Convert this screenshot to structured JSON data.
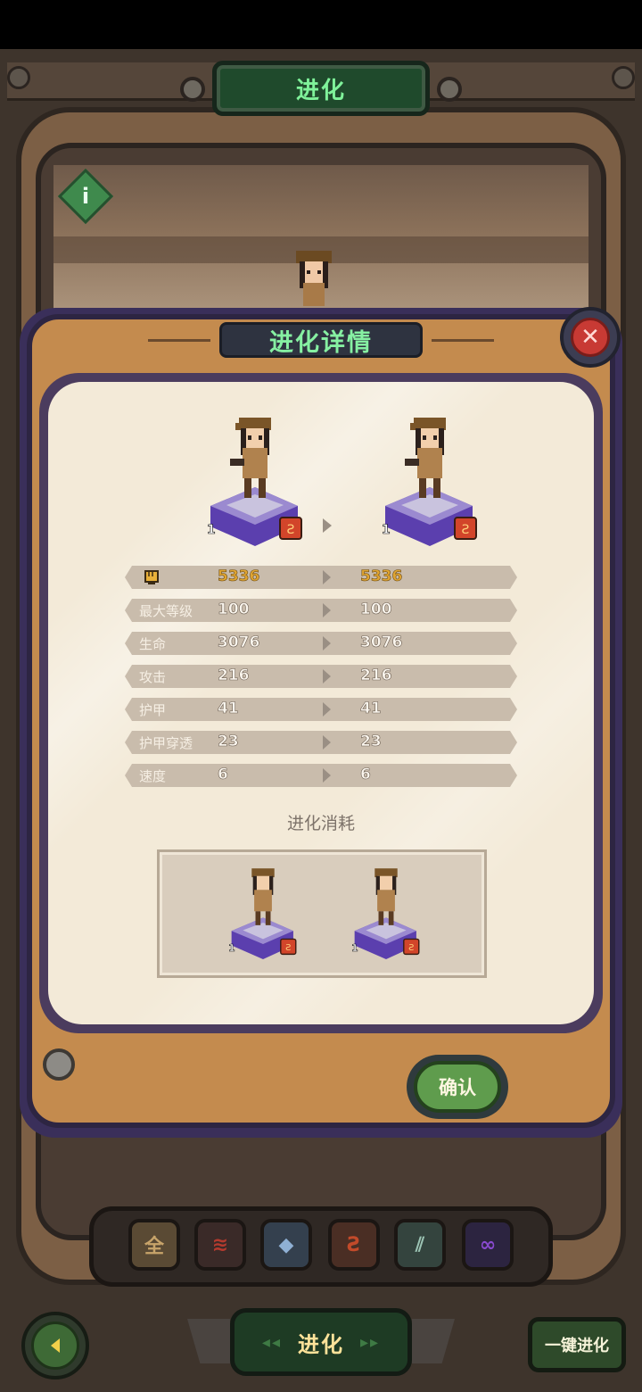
{
  "header": {
    "title": "进化"
  },
  "modal": {
    "title": "进化详情",
    "before_level": "1",
    "after_level": "1",
    "stats": [
      {
        "label": "",
        "icon": "fist-icon",
        "before": "5336",
        "after": "5336"
      },
      {
        "label": "最大等级",
        "before": "100",
        "after": "100"
      },
      {
        "label": "生命",
        "before": "3076",
        "after": "3076"
      },
      {
        "label": "攻击",
        "before": "216",
        "after": "216"
      },
      {
        "label": "护甲",
        "before": "41",
        "after": "41"
      },
      {
        "label": "护甲穿透",
        "before": "23",
        "after": "23"
      },
      {
        "label": "速度",
        "before": "6",
        "after": "6"
      }
    ],
    "cost_title": "进化消耗",
    "cost_units": [
      {
        "level": "1"
      },
      {
        "level": "1"
      }
    ],
    "confirm_label": "确认"
  },
  "filters": [
    {
      "name": "all",
      "glyph": "全",
      "color": "#c8a46a"
    },
    {
      "name": "fire",
      "glyph": "≋",
      "color": "#b43a2e"
    },
    {
      "name": "beast",
      "glyph": "◆",
      "color": "#5d7fa8"
    },
    {
      "name": "dragon",
      "glyph": "Ƨ",
      "color": "#c24a2a"
    },
    {
      "name": "claw",
      "glyph": "⫽",
      "color": "#5e8a7a"
    },
    {
      "name": "infinity",
      "glyph": "∞",
      "color": "#8a4ad0"
    }
  ],
  "bottom_nav": {
    "tab_label": "进化",
    "one_key_label": "一键进化"
  },
  "colors": {
    "title_green": "#7ff29a",
    "power_gold": "#e0a532",
    "pedestal_purple": "#7a52d6",
    "confirm_green": "#5f9c4d",
    "close_red": "#c83a34"
  }
}
